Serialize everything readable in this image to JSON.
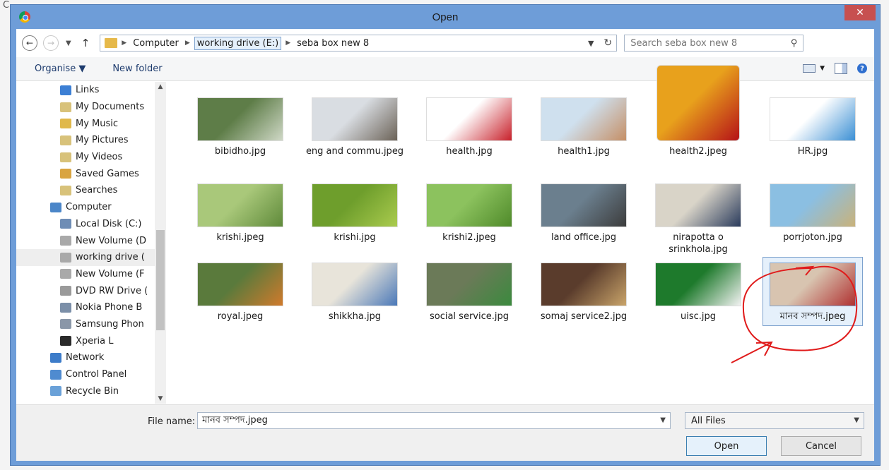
{
  "dialog": {
    "title": "Open",
    "close_label": "✕"
  },
  "address": {
    "crumbs": [
      "Computer",
      "working drive (E:)",
      "seba box new 8"
    ],
    "search_placeholder": "Search seba box new 8"
  },
  "toolbar": {
    "organise": "Organise ▼",
    "new_folder": "New folder"
  },
  "nav": {
    "items": [
      {
        "label": "Links",
        "color": "#3c7fd4",
        "indent": 1
      },
      {
        "label": "My Documents",
        "color": "#d8c27a",
        "indent": 1
      },
      {
        "label": "My Music",
        "color": "#e0b84a",
        "indent": 1
      },
      {
        "label": "My Pictures",
        "color": "#d8c27a",
        "indent": 1
      },
      {
        "label": "My Videos",
        "color": "#d8c27a",
        "indent": 1
      },
      {
        "label": "Saved Games",
        "color": "#d9a440",
        "indent": 1
      },
      {
        "label": "Searches",
        "color": "#d8c27a",
        "indent": 1
      },
      {
        "label": "Computer",
        "color": "#4b86c8",
        "indent": 0
      },
      {
        "label": "Local Disk (C:)",
        "color": "#6e8db5",
        "indent": 1
      },
      {
        "label": "New Volume (D",
        "color": "#a9a9a9",
        "indent": 1
      },
      {
        "label": "working drive (",
        "color": "#a9a9a9",
        "indent": 1
      },
      {
        "label": "New Volume (F",
        "color": "#a9a9a9",
        "indent": 1
      },
      {
        "label": "DVD RW Drive (",
        "color": "#9a9a9a",
        "indent": 1
      },
      {
        "label": "Nokia Phone B",
        "color": "#7b8fa8",
        "indent": 1
      },
      {
        "label": "Samsung Phon",
        "color": "#8a97a8",
        "indent": 1
      },
      {
        "label": "Xperia L",
        "color": "#2a2a2a",
        "indent": 1
      },
      {
        "label": "Network",
        "color": "#3d7cc9",
        "indent": 0
      },
      {
        "label": "Control Panel",
        "color": "#4f8bd0",
        "indent": 0
      },
      {
        "label": "Recycle Bin",
        "color": "#6aa1d8",
        "indent": 0
      }
    ]
  },
  "files": [
    {
      "name": "bibidho.jpg",
      "c1": "#5e7d48",
      "c2": "#cfd8c6"
    },
    {
      "name": "eng and commu.jpeg",
      "c1": "#d9dde2",
      "c2": "#6b6257"
    },
    {
      "name": "health.jpg",
      "c1": "#ffffff",
      "c2": "#c8202a"
    },
    {
      "name": "health1.jpg",
      "c1": "#cfe0ee",
      "c2": "#c58f66"
    },
    {
      "name": "health2.jpeg",
      "c1": "#e8a11c",
      "c2": "#b51218"
    },
    {
      "name": "HR.jpg",
      "c1": "#ffffff",
      "c2": "#3b8fd4"
    },
    {
      "name": "krishi.jpeg",
      "c1": "#a9c87a",
      "c2": "#5f8a3a"
    },
    {
      "name": "krishi.jpg",
      "c1": "#6e9e2c",
      "c2": "#aacb4e"
    },
    {
      "name": "krishi2.jpeg",
      "c1": "#8cc25e",
      "c2": "#4f8a2a"
    },
    {
      "name": "land office.jpg",
      "c1": "#6b7f8e",
      "c2": "#3c3c3c"
    },
    {
      "name": "nirapotta o srinkhola.jpg",
      "c1": "#d9d4c8",
      "c2": "#2a3b5c"
    },
    {
      "name": "porrjoton.jpg",
      "c1": "#8bbfe2",
      "c2": "#c9b27a"
    },
    {
      "name": "royal.jpeg",
      "c1": "#5a7a3c",
      "c2": "#d07a2c"
    },
    {
      "name": "shikkha.jpg",
      "c1": "#e8e4da",
      "c2": "#4a78b8"
    },
    {
      "name": "social service.jpg",
      "c1": "#6b7a58",
      "c2": "#3b8a3e"
    },
    {
      "name": "somaj service2.jpg",
      "c1": "#5a3c2c",
      "c2": "#c9a46a"
    },
    {
      "name": "uisc.jpg",
      "c1": "#1e7a2c",
      "c2": "#f2f2f2"
    },
    {
      "name": "মানব সম্পদ.jpeg",
      "c1": "#d8c4b0",
      "c2": "#b03030",
      "selected": true
    }
  ],
  "bottom": {
    "filename_label": "File name:",
    "filename_value": "মানব সম্পদ.jpeg",
    "type_value": "All Files",
    "open_label": "Open",
    "cancel_label": "Cancel"
  },
  "colors": {
    "frame": "#6e9dd8",
    "close": "#c75050",
    "annotation": "#e01b1b"
  }
}
